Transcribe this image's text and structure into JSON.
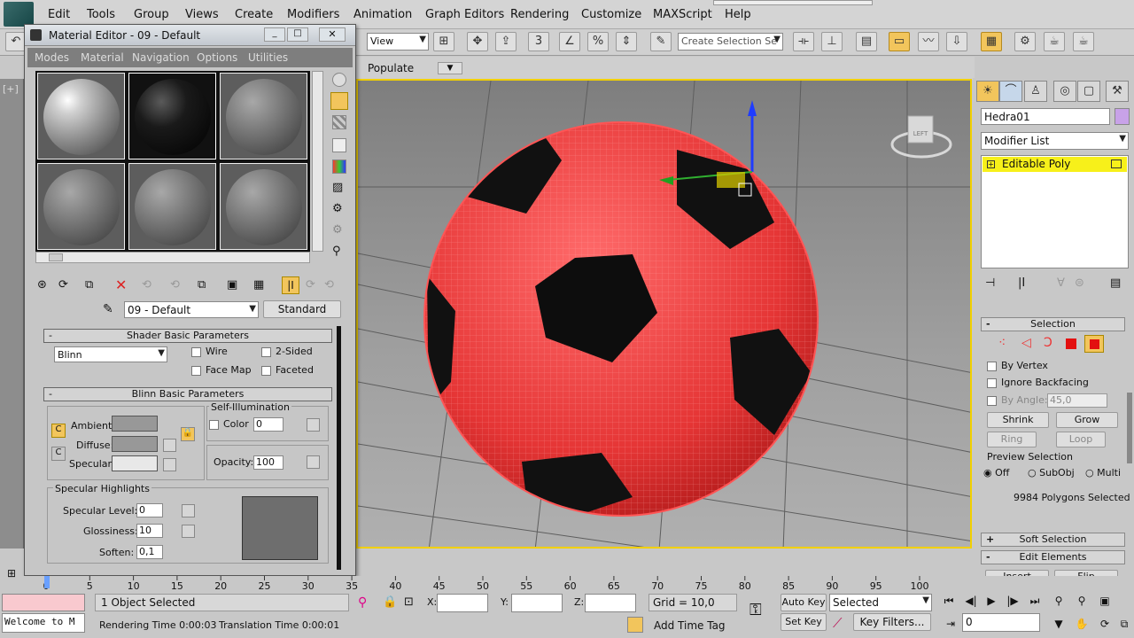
{
  "menu": [
    "Edit",
    "Tools",
    "Group",
    "Views",
    "Create",
    "Modifiers",
    "Animation",
    "Graph Editors",
    "Rendering",
    "Customize",
    "MAXScript",
    "Help"
  ],
  "toolbar": {
    "view_dropdown": "View",
    "selection_set_placeholder": "Create Selection Se",
    "populate_label": "Populate"
  },
  "material_editor": {
    "title": "Material Editor - 09 - Default",
    "menu": [
      "Modes",
      "Material",
      "Navigation",
      "Options",
      "Utilities"
    ],
    "material_name": "09 - Default",
    "material_type": "Standard",
    "shader_section": "Shader Basic Parameters",
    "shader": "Blinn",
    "wire": "Wire",
    "two_sided": "2-Sided",
    "face_map": "Face Map",
    "faceted": "Faceted",
    "blinn_section": "Blinn Basic Parameters",
    "self_illum_label": "Self-Illumination",
    "ambient": "Ambient:",
    "diffuse": "Diffuse:",
    "specular": "Specular:",
    "color_label": "Color",
    "color_value": "0",
    "opacity_label": "Opacity:",
    "opacity_value": "100",
    "spec_highlights": "Specular Highlights",
    "spec_level_label": "Specular Level:",
    "spec_level": "0",
    "glossiness_label": "Glossiness:",
    "glossiness": "10",
    "soften_label": "Soften:",
    "soften": "0,1"
  },
  "command_panel": {
    "object_name": "Hedra01",
    "object_color": "#c8a2e8",
    "modifier_list": "Modifier List",
    "stack_item": "Editable Poly",
    "selection_title": "Selection",
    "by_vertex": "By Vertex",
    "ignore_backfacing": "Ignore Backfacing",
    "by_angle": "By Angle:",
    "angle_value": "45,0",
    "shrink": "Shrink",
    "grow": "Grow",
    "ring": "Ring",
    "loop": "Loop",
    "preview_selection": "Preview Selection",
    "off": "Off",
    "subobj": "SubObj",
    "multi": "Multi",
    "polys_selected": "9984 Polygons Selected",
    "soft_selection": "Soft Selection",
    "edit_elements": "Edit Elements",
    "insert_vertex": "Insert Vertex",
    "flip": "Flip"
  },
  "viewport": {
    "corner_label": "[+]",
    "viewcube_label": "LEFT",
    "ball_color": "#e83a3a",
    "grid_color": "#5a5a5a"
  },
  "timeline": {
    "ticks": [
      "0",
      "5",
      "10",
      "15",
      "20",
      "25",
      "30",
      "35",
      "40",
      "45",
      "50",
      "55",
      "60",
      "65",
      "70",
      "75",
      "80",
      "85",
      "90",
      "95",
      "100"
    ]
  },
  "status": {
    "maxscript": "Welcome to M",
    "objects_selected": "1 Object Selected",
    "render_time": "Rendering Time  0:00:03",
    "translation_time": "Translation Time  0:00:01",
    "x_label": "X:",
    "y_label": "Y:",
    "z_label": "Z:",
    "grid": "Grid = 10,0",
    "auto_key": "Auto Key",
    "set_key": "Set Key",
    "selected_dropdown": "Selected",
    "key_filters": "Key Filters...",
    "add_time_tag": "Add Time Tag",
    "frame": "0"
  }
}
